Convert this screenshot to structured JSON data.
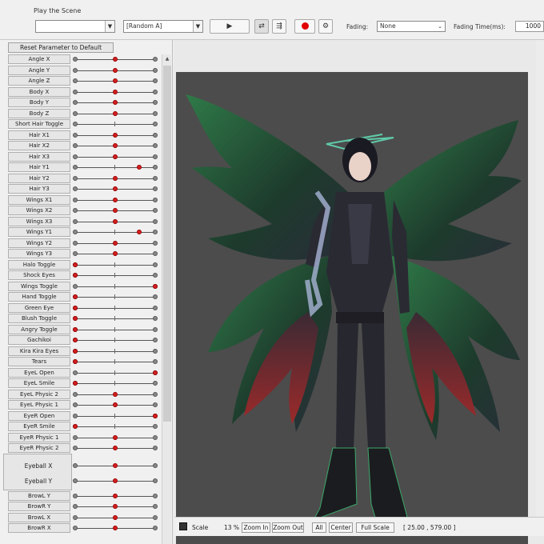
{
  "toolbar": {
    "scene_label": "Play the Scene",
    "scene_value": "",
    "random_value": "[Random A]",
    "fading_label": "Fading:",
    "fading_value": "None",
    "fading_time_label": "Fading Time(ms):",
    "fading_time_value": "1000"
  },
  "params": {
    "reset_label": "Reset Parameter to Default",
    "eyeball_x": "Eyeball X",
    "eyeball_y": "Eyeball Y",
    "rows": [
      {
        "label": "Angle X",
        "value": 0.5
      },
      {
        "label": "Angle Y",
        "value": 0.5
      },
      {
        "label": "Angle Z",
        "value": 0.5
      },
      {
        "label": "Body X",
        "value": 0.5
      },
      {
        "label": "Body Y",
        "value": 0.5
      },
      {
        "label": "Body Z",
        "value": 0.5
      },
      {
        "label": "Short Hair Toggle",
        "value": null
      },
      {
        "label": "Hair X1",
        "value": 0.5
      },
      {
        "label": "Hair X2",
        "value": 0.5
      },
      {
        "label": "Hair X3",
        "value": 0.5
      },
      {
        "label": "Hair Y1",
        "value": 0.8
      },
      {
        "label": "Hair Y2",
        "value": 0.5
      },
      {
        "label": "Hair Y3",
        "value": 0.5
      },
      {
        "label": "Wings X1",
        "value": 0.5
      },
      {
        "label": "Wings X2",
        "value": 0.5
      },
      {
        "label": "Wings X3",
        "value": 0.5
      },
      {
        "label": "Wings Y1",
        "value": 0.8
      },
      {
        "label": "Wings Y2",
        "value": 0.5
      },
      {
        "label": "Wings Y3",
        "value": 0.5
      },
      {
        "label": "Halo Toggle",
        "value": 0.0
      },
      {
        "label": "Shock Eyes",
        "value": 0.0
      },
      {
        "label": "Wings Toggle",
        "value": 1.0
      },
      {
        "label": "Hand Toggle",
        "value": 0.0
      },
      {
        "label": "Green Eye",
        "value": 0.0
      },
      {
        "label": "Blush Toggle",
        "value": 0.0
      },
      {
        "label": "Angry Toggle",
        "value": 0.0
      },
      {
        "label": "Gachikoi",
        "value": 0.0
      },
      {
        "label": "Kira Kira Eyes",
        "value": 0.0
      },
      {
        "label": "Tears",
        "value": 0.0
      },
      {
        "label": "EyeL Open",
        "value": 1.0
      },
      {
        "label": "EyeL Smile",
        "value": 0.0
      },
      {
        "label": "EyeL Physic 2",
        "value": 0.5
      },
      {
        "label": "EyeL Physic 1",
        "value": 0.5
      },
      {
        "label": "EyeR Open",
        "value": 1.0
      },
      {
        "label": "EyeR Smile",
        "value": 0.0
      },
      {
        "label": "EyeR Physic 1",
        "value": 0.5
      },
      {
        "label": "EyeR Physic 2",
        "value": 0.5
      },
      {
        "label": "BrowL Y",
        "value": 0.5
      },
      {
        "label": "BrowR Y",
        "value": 0.5
      },
      {
        "label": "BrowL X",
        "value": 0.5
      },
      {
        "label": "BrowR X",
        "value": 0.5
      }
    ]
  },
  "bottom": {
    "scale_label": "Scale",
    "scale_value": "13 %",
    "zoom_in": "Zoom In",
    "zoom_out": "Zoom Out",
    "all": "All",
    "center": "Center",
    "full_scale": "Full Scale",
    "coords": "[ 25.00 , 579.00 ]"
  },
  "colors": {
    "knob": "#d42020",
    "canvas_bg": "#4c4c4c"
  }
}
